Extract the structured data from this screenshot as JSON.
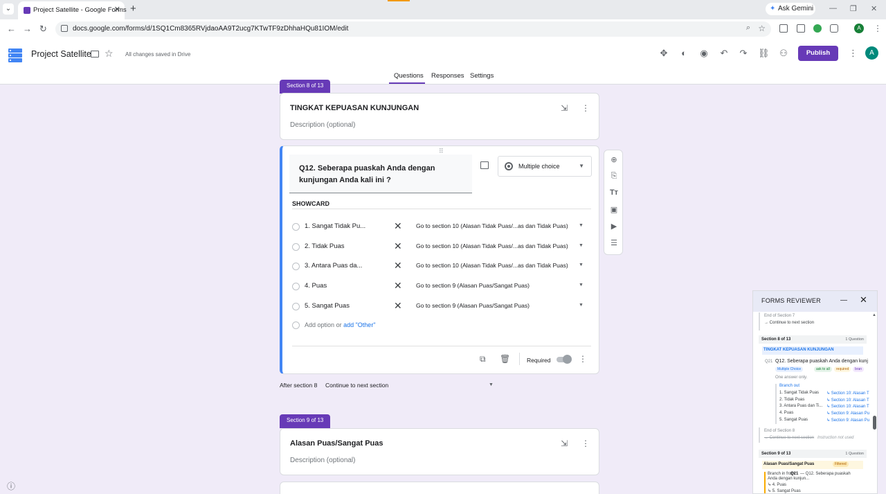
{
  "browser": {
    "tab_title": "Project Satellite - Google Forms",
    "url": "docs.google.com/forms/d/1SQ1Cm8365RVjdaoAA9T2ucg7KTwTF9zDhhaHQu81IOM/edit",
    "gemini_label": "Ask Gemini",
    "profile_initial": "A"
  },
  "header": {
    "form_title": "Project Satellite",
    "save_status": "All changes saved in Drive",
    "publish_label": "Publish",
    "avatar_initial": "A",
    "tabs": [
      "Questions",
      "Responses",
      "Settings"
    ],
    "active_tab": "Questions"
  },
  "section8": {
    "chip": "Section 8 of 13",
    "title": "TINGKAT KEPUASAN KUNJUNGAN",
    "description": "Description (optional)"
  },
  "question": {
    "text": "Q12. Seberapa puaskah Anda dengan kunjungan Anda kali ini ?",
    "type": "Multiple choice",
    "subtitle": "SHOWCARD",
    "options": [
      {
        "label": "1. Sangat Tidak Pu...",
        "goto": "Go to section 10 (Alasan Tidak Puas/...as dan Tidak Puas)"
      },
      {
        "label": "2. Tidak Puas",
        "goto": "Go to section 10 (Alasan Tidak Puas/...as dan Tidak Puas)"
      },
      {
        "label": "3. Antara Puas da...",
        "goto": "Go to section 10 (Alasan Tidak Puas/...as dan Tidak Puas)"
      },
      {
        "label": "4. Puas",
        "goto": "Go to section 9 (Alasan Puas/Sangat Puas)"
      },
      {
        "label": "5. Sangat Puas",
        "goto": "Go to section 9 (Alasan Puas/Sangat Puas)"
      }
    ],
    "add_option": "Add option",
    "or": "or",
    "add_other": "add \"Other\"",
    "required_label": "Required"
  },
  "after_section": {
    "label": "After section 8",
    "value": "Continue to next section"
  },
  "section9": {
    "chip": "Section 9 of 13",
    "title": "Alasan Puas/Sangat Puas",
    "description": "Description (optional)"
  },
  "reviewer": {
    "title": "FORMS REVIEWER",
    "end7": "End of Section 7",
    "end7_action": "→ Continue to next section",
    "sec8_head": "Section 8 of 13",
    "sec8_count": "1 Question",
    "sec8_title": "TINGKAT KEPUASAN KUNJUNGAN",
    "q_id": "Q21",
    "q_text": "Q12. Seberapa puaskah Anda dengan kunj",
    "chips": [
      "Multiple Choice",
      "ask to all",
      "required",
      "bran"
    ],
    "one_answer": "One answer only.",
    "branch_out": "Branch out",
    "branches": [
      {
        "opt": "1. Sangat Tidak Puas",
        "to": "↳ Section 10: Alasan T"
      },
      {
        "opt": "2. Tidak Puas",
        "to": "↳ Section 10: Alasan T"
      },
      {
        "opt": "3. Antara Puas dan Ti...",
        "to": "↳ Section 10: Alasan T"
      },
      {
        "opt": "4. Puas",
        "to": "↳ Section 9: Alasan Pu"
      },
      {
        "opt": "5. Sangat Puas",
        "to": "↳ Section 9: Alasan Pu"
      }
    ],
    "end8": "End of Section 8",
    "end8_action": "→ Continue to next section",
    "end8_note": "Instruction not used",
    "sec9_head": "Section 9 of 13",
    "sec9_count": "1 Question",
    "sec9_title": "Alasan Puas/Sangat Puas",
    "sec9_badge": "Filtered",
    "branch_in_prefix": "Branch in from",
    "branch_in_q": "Q21",
    "branch_in_rest": "— Q12. Seberapa puaskah",
    "branch_in_line2": "Anda dengan kunjun...",
    "branch_in_opt1": "↳ 4. Puas",
    "branch_in_opt2": "↳ 5. Sangat Puas"
  },
  "colors": {
    "accent": "#673ab7",
    "background": "#f0ebf8",
    "active_question": "#4285f4",
    "link": "#1a73e8"
  }
}
